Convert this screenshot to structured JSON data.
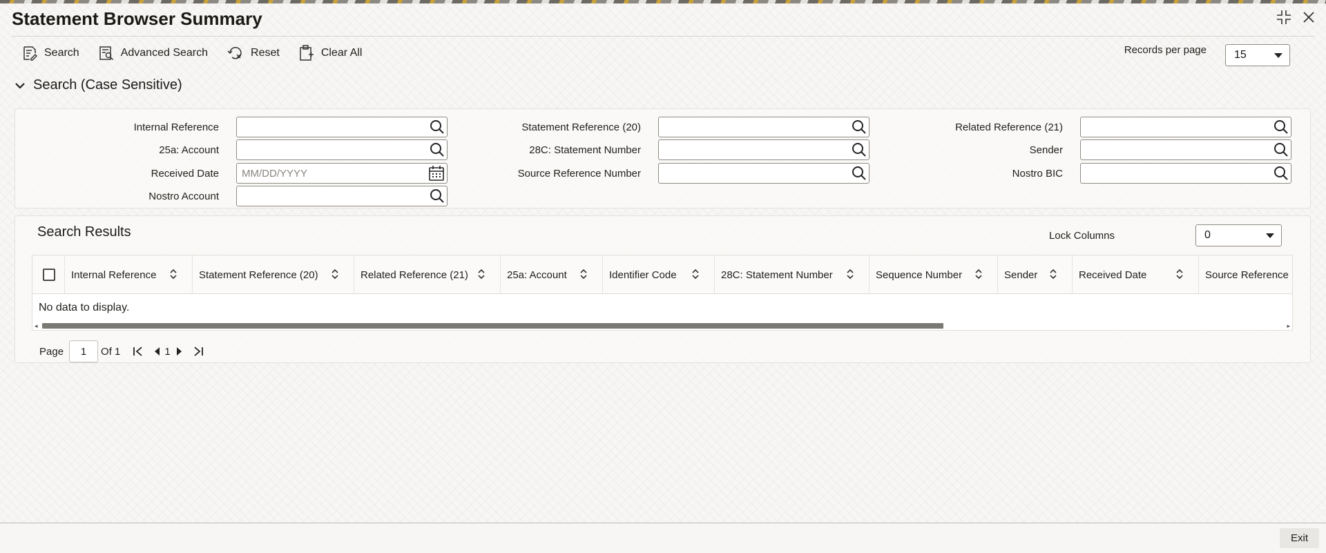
{
  "window": {
    "title": "Statement Browser Summary"
  },
  "toolbar": {
    "search_label": "Search",
    "advanced_search_label": "Advanced Search",
    "reset_label": "Reset",
    "clear_all_label": "Clear All"
  },
  "records_per_page": {
    "label": "Records per page",
    "value": "15"
  },
  "search_section": {
    "title": "Search (Case Sensitive)",
    "fields": {
      "internal_reference": {
        "label": "Internal Reference",
        "value": ""
      },
      "account_25a": {
        "label": "25a: Account",
        "value": ""
      },
      "received_date": {
        "label": "Received Date",
        "placeholder": "MM/DD/YYYY"
      },
      "nostro_account": {
        "label": "Nostro Account",
        "value": ""
      },
      "statement_reference_20": {
        "label": "Statement Reference (20)",
        "value": ""
      },
      "statement_number_28c": {
        "label": "28C: Statement Number",
        "value": ""
      },
      "source_reference_number": {
        "label": "Source Reference Number",
        "value": ""
      },
      "related_reference_21": {
        "label": "Related Reference (21)",
        "value": ""
      },
      "sender": {
        "label": "Sender",
        "value": ""
      },
      "nostro_bic": {
        "label": "Nostro BIC",
        "value": ""
      }
    }
  },
  "results": {
    "title": "Search Results",
    "lock_columns_label": "Lock Columns",
    "lock_columns_value": "0",
    "columns": [
      "Internal Reference",
      "Statement Reference (20)",
      "Related Reference (21)",
      "25a: Account",
      "Identifier Code",
      "28C: Statement Number",
      "Sequence Number",
      "Sender",
      "Received Date",
      "Source Reference N"
    ],
    "empty_message": "No data to display."
  },
  "pagination": {
    "page_label": "Page",
    "current_page": "1",
    "of_label": "Of 1",
    "page_number": "1"
  },
  "footer": {
    "exit_label": "Exit"
  }
}
